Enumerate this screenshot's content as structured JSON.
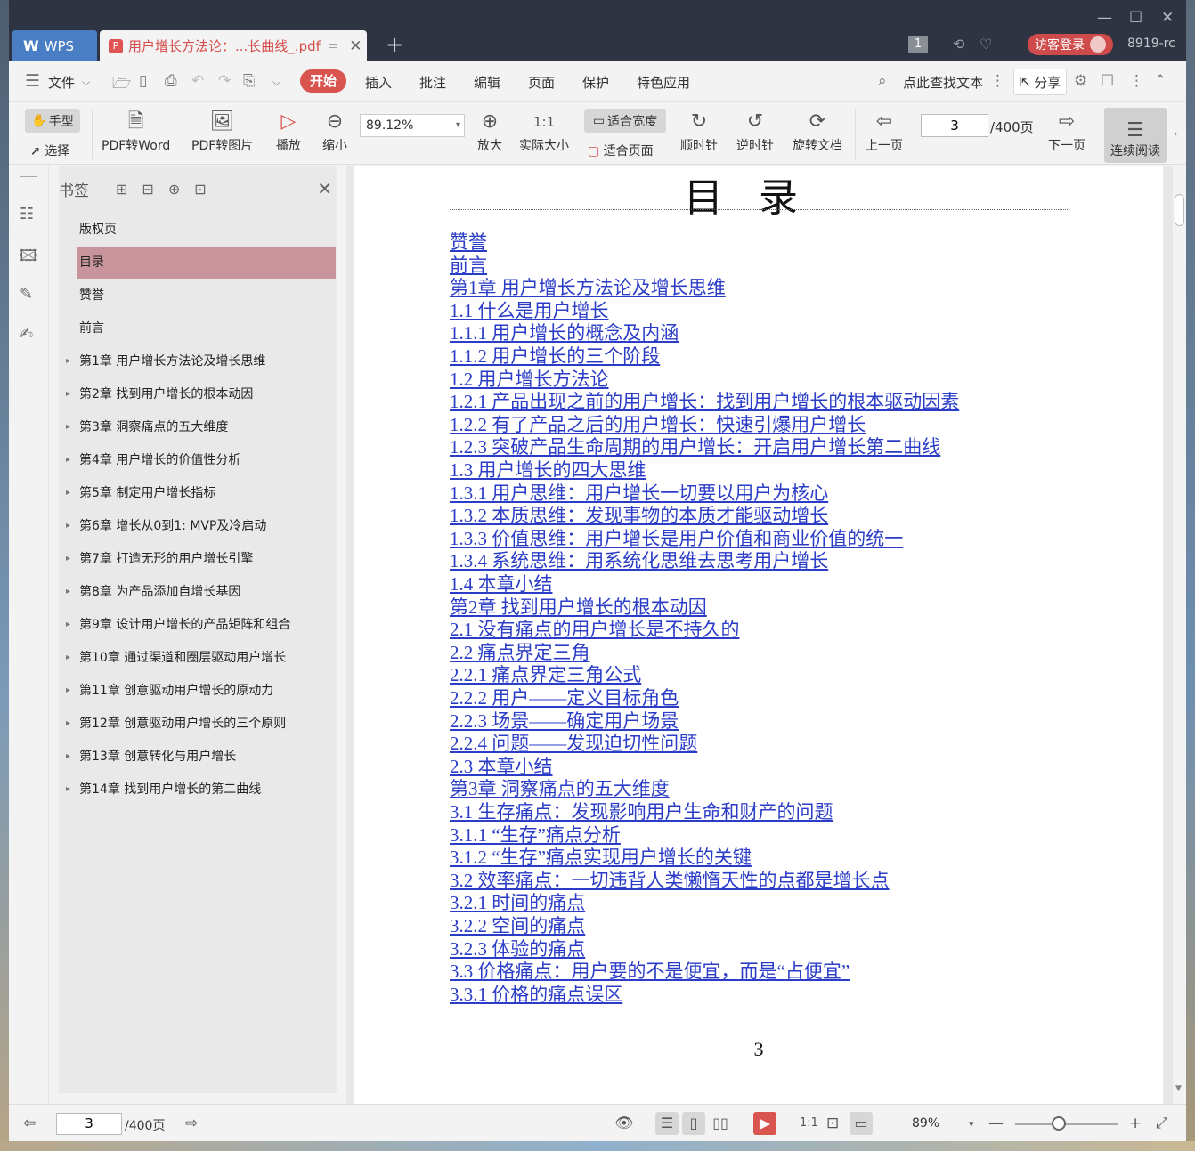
{
  "titlebar": {
    "app_tab": "WPS",
    "app_logo": "W",
    "doc_tab": "用户增长方法论：...长曲线_.pdf",
    "login_label": "访客登录",
    "user_id": "8919-rc",
    "badge": "1"
  },
  "menu": {
    "file": "文件",
    "tabs": [
      "开始",
      "插入",
      "批注",
      "编辑",
      "页面",
      "保护",
      "特色应用"
    ],
    "search": "点此查找文本",
    "share": "分享"
  },
  "toolbar": {
    "hand": "手型",
    "select": "选择",
    "pdf_to_word": "PDF转Word",
    "pdf_to_image": "PDF转图片",
    "play": "播放",
    "zoom_out": "缩小",
    "zoom_value": "89.12%",
    "zoom_in": "放大",
    "actual_size": "实际大小",
    "fit_width": "适合宽度",
    "fit_page": "适合页面",
    "clockwise": "顺时针",
    "counterclockwise": "逆时针",
    "rotate_doc": "旋转文档",
    "prev_page": "上一页",
    "current_page": "3",
    "total_pages": "/400页",
    "next_page": "下一页",
    "continuous": "连续阅读"
  },
  "bookmarks": {
    "title": "书签",
    "items": [
      {
        "label": "版权页",
        "expandable": false,
        "active": false
      },
      {
        "label": "目录",
        "expandable": false,
        "active": true
      },
      {
        "label": "赞誉",
        "expandable": false,
        "active": false
      },
      {
        "label": "前言",
        "expandable": false,
        "active": false
      },
      {
        "label": "第1章 用户增长方法论及增长思维",
        "expandable": true,
        "active": false
      },
      {
        "label": "第2章 找到用户增长的根本动因",
        "expandable": true,
        "active": false
      },
      {
        "label": "第3章 洞察痛点的五大维度",
        "expandable": true,
        "active": false
      },
      {
        "label": "第4章 用户增长的价值性分析",
        "expandable": true,
        "active": false
      },
      {
        "label": "第5章 制定用户增长指标",
        "expandable": true,
        "active": false
      },
      {
        "label": "第6章 增长从0到1: MVP及冷启动",
        "expandable": true,
        "active": false
      },
      {
        "label": "第7章 打造无形的用户增长引擎",
        "expandable": true,
        "active": false
      },
      {
        "label": "第8章 为产品添加自增长基因",
        "expandable": true,
        "active": false
      },
      {
        "label": "第9章 设计用户增长的产品矩阵和组合",
        "expandable": true,
        "active": false
      },
      {
        "label": "第10章 通过渠道和圈层驱动用户增长",
        "expandable": true,
        "active": false
      },
      {
        "label": "第11章 创意驱动用户增长的原动力",
        "expandable": true,
        "active": false
      },
      {
        "label": "第12章 创意驱动用户增长的三个原则",
        "expandable": true,
        "active": false
      },
      {
        "label": "第13章 创意转化与用户增长",
        "expandable": true,
        "active": false
      },
      {
        "label": "第14章 找到用户增长的第二曲线",
        "expandable": true,
        "active": false
      }
    ]
  },
  "document": {
    "title": "目录",
    "page_number": "3",
    "toc": [
      "赞誉",
      "前言",
      "第1章 用户增长方法论及增长思维",
      "1.1 什么是用户增长",
      "1.1.1 用户增长的概念及内涵",
      "1.1.2 用户增长的三个阶段",
      "1.2 用户增长方法论",
      "1.2.1 产品出现之前的用户增长：找到用户增长的根本驱动因素",
      "1.2.2 有了产品之后的用户增长：快速引爆用户增长",
      "1.2.3 突破产品生命周期的用户增长：开启用户增长第二曲线",
      "1.3 用户增长的四大思维",
      "1.3.1 用户思维：用户增长一切要以用户为核心",
      "1.3.2 本质思维：发现事物的本质才能驱动增长",
      "1.3.3 价值思维：用户增长是用户价值和商业价值的统一",
      "1.3.4 系统思维：用系统化思维去思考用户增长",
      "1.4 本章小结",
      "第2章 找到用户增长的根本动因",
      "2.1 没有痛点的用户增长是不持久的",
      "2.2 痛点界定三角",
      "2.2.1 痛点界定三角公式",
      "2.2.2 用户——定义目标角色",
      "2.2.3 场景——确定用户场景",
      "2.2.4 问题——发现迫切性问题",
      "2.3 本章小结",
      "第3章 洞察痛点的五大维度",
      "3.1 生存痛点：发现影响用户生命和财产的问题",
      "3.1.1 “生存”痛点分析",
      "3.1.2 “生存”痛点实现用户增长的关键",
      "3.2 效率痛点：一切违背人类懒惰天性的点都是增长点",
      "3.2.1 时间的痛点",
      "3.2.2 空间的痛点",
      "3.2.3 体验的痛点",
      "3.3 价格痛点：用户要的不是便宜，而是“占便宜”",
      "3.3.1 价格的痛点误区"
    ]
  },
  "statusbar": {
    "current_page": "3",
    "total_pages": "/400页",
    "zoom": "89%"
  },
  "colors": {
    "accent_red": "#d9534f",
    "link_blue": "#2b3dc7",
    "bookmark_active": "#c9959c"
  }
}
